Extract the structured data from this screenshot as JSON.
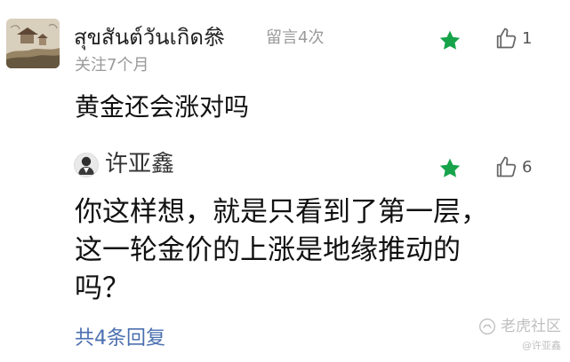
{
  "comment": {
    "user_name": "สุขสันต์วันเกิด叅",
    "message_count": "留言4次",
    "follow_time": "关注7个月",
    "like_count": "1",
    "text": "黄金还会涨对吗",
    "star_color": "#16a34a"
  },
  "reply": {
    "user_name": "许亚鑫",
    "like_count": "6",
    "text_lines": [
      "你这样想，就是只看到了第一层，",
      "这一轮金价的上涨是地缘推动的",
      "吗？"
    ]
  },
  "footer": {
    "total_replies": "共4条回复",
    "link_color": "#4a6fb0"
  },
  "watermark": {
    "brand": "老虎社区",
    "user": "@许亚鑫"
  },
  "icons": {
    "star": "star-icon",
    "like": "thumbs-up-icon",
    "brand": "tiger-logo-icon"
  }
}
